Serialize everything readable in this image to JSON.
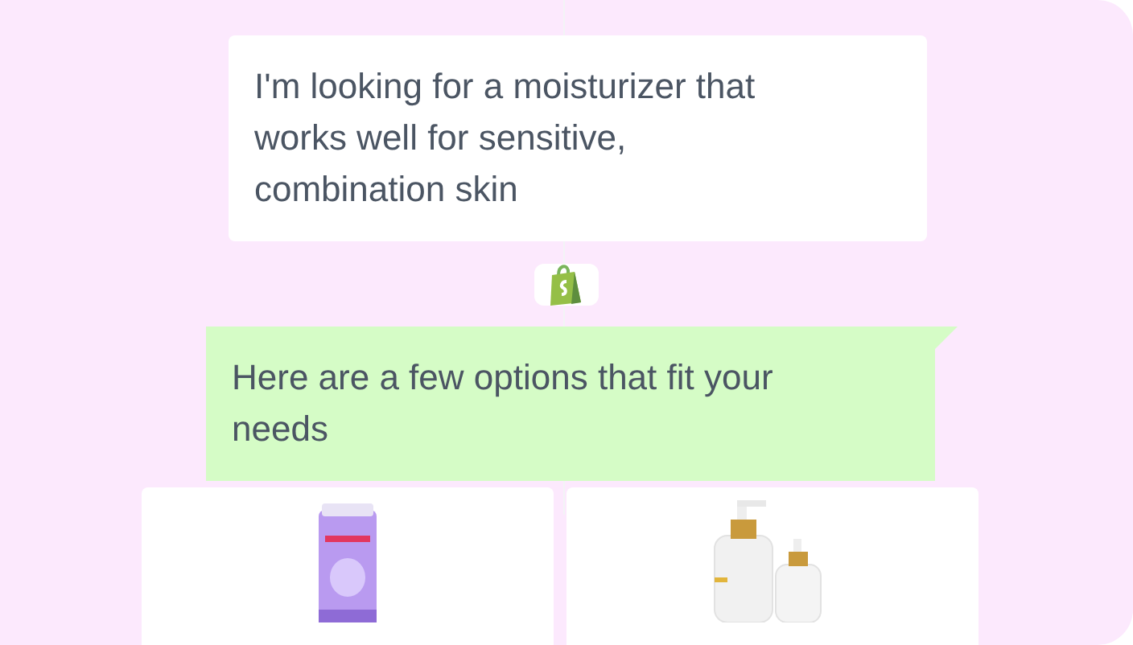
{
  "messages": [
    {
      "kind": "user",
      "text": "I'm looking for a moisturizer that works well for sensitive, combination skin"
    },
    {
      "kind": "assistant",
      "text": "Here are a few options that fit your needs"
    }
  ]
}
